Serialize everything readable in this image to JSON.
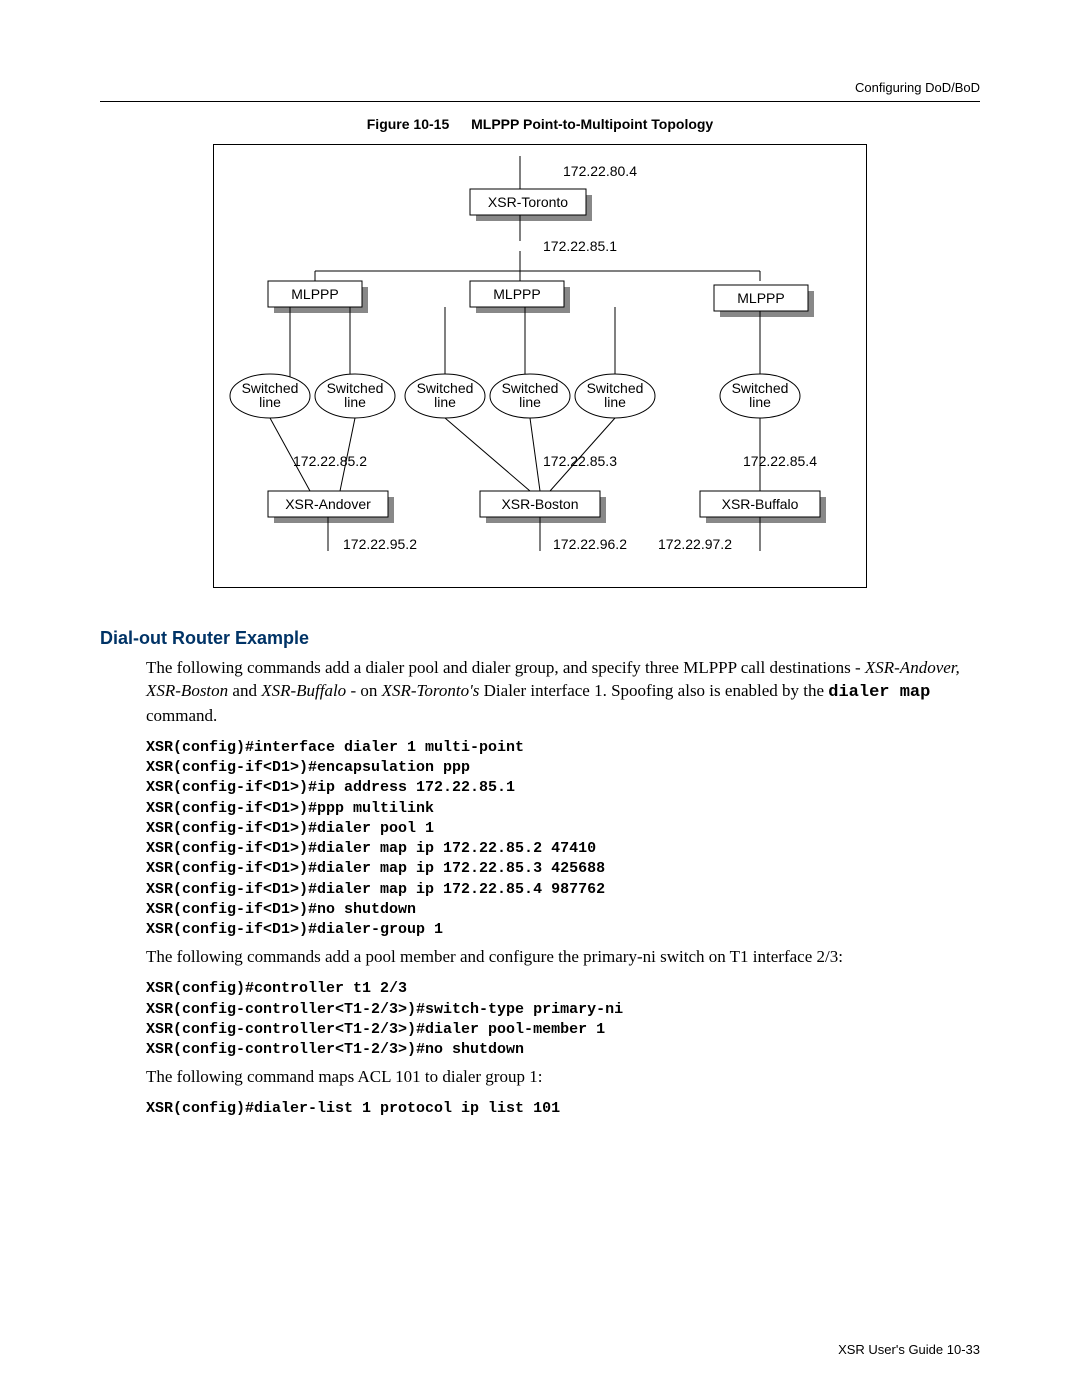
{
  "header": "Configuring DoD/BoD",
  "figure": {
    "number": "Figure 10-15",
    "title": "MLPPP Point-to-Multipoint Topology",
    "nodes": {
      "hub": {
        "name": "XSR-Toronto",
        "wanIp": "172.22.80.4",
        "dialerIp": "172.22.85.1"
      },
      "mlppp": [
        "MLPPP",
        "MLPPP",
        "MLPPP"
      ],
      "switchedLine": "Switched line",
      "spokes": [
        {
          "name": "XSR-Andover",
          "dialerIp": "172.22.85.2",
          "lanIp": "172.22.95.2"
        },
        {
          "name": "XSR-Boston",
          "dialerIp": "172.22.85.3",
          "lanIp": "172.22.96.2"
        },
        {
          "name": "XSR-Buffalo",
          "dialerIp": "172.22.85.4",
          "lanIp": "172.22.97.2"
        }
      ]
    }
  },
  "section": {
    "heading": "Dial-out Router Example",
    "intro_part1": "The following commands add a dialer pool and dialer group, and specify three MLPPP call destinations - ",
    "intro_ital1": "XSR-Andover, XSR-Boston",
    "intro_and": " and ",
    "intro_ital2": "XSR-Buffalo",
    "intro_on": " - on ",
    "intro_ital3": "XSR-Toronto's",
    "intro_part2": " Dialer interface 1. Spoofing also is enabled by the ",
    "intro_mono": "dialer map",
    "intro_end": " command.",
    "code1": "XSR(config)#interface dialer 1 multi-point\nXSR(config-if<D1>)#encapsulation ppp\nXSR(config-if<D1>)#ip address 172.22.85.1\nXSR(config-if<D1>)#ppp multilink\nXSR(config-if<D1>)#dialer pool 1\nXSR(config-if<D1>)#dialer map ip 172.22.85.2 47410\nXSR(config-if<D1>)#dialer map ip 172.22.85.3 425688\nXSR(config-if<D1>)#dialer map ip 172.22.85.4 987762\nXSR(config-if<D1>)#no shutdown\nXSR(config-if<D1>)#dialer-group 1",
    "para2": "The following commands add a pool member and configure the primary-ni switch on T1 interface 2/3:",
    "code2": "XSR(config)#controller t1 2/3\nXSR(config-controller<T1-2/3>)#switch-type primary-ni\nXSR(config-controller<T1-2/3>)#dialer pool-member 1\nXSR(config-controller<T1-2/3>)#no shutdown",
    "para3": "The following command maps ACL 101 to dialer group 1:",
    "code3": "XSR(config)#dialer-list 1 protocol ip list 101"
  },
  "footer": "XSR User's Guide  10-33"
}
